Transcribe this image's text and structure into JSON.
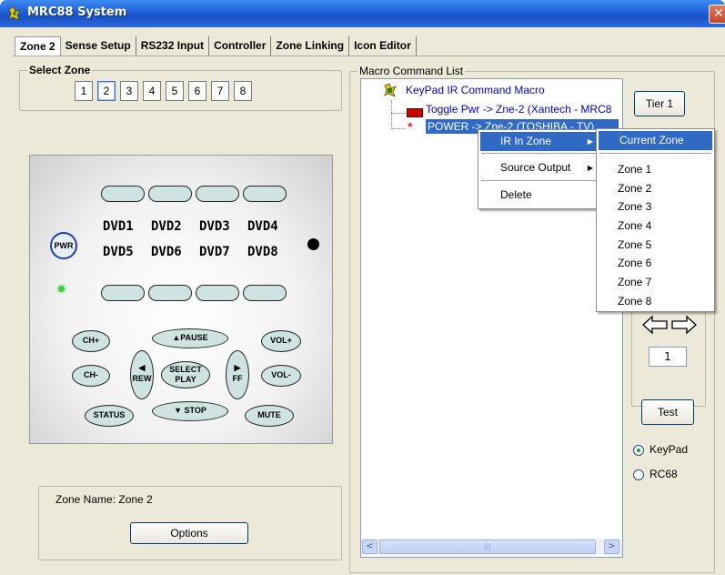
{
  "window": {
    "title": "MRC88 System",
    "close_glyph": "✕"
  },
  "tabs": [
    "Zone 2",
    "Sense Setup",
    "RS232 Input",
    "Controller",
    "Zone Linking",
    "Icon Editor"
  ],
  "select_zone": {
    "label": "Select Zone",
    "buttons": [
      "1",
      "2",
      "3",
      "4",
      "5",
      "6",
      "7",
      "8"
    ],
    "selected": "2"
  },
  "keypad": {
    "power_label": "PWR",
    "dvd_row1": [
      "DVD1",
      "DVD2",
      "DVD3",
      "DVD4"
    ],
    "dvd_row2": [
      "DVD5",
      "DVD6",
      "DVD7",
      "DVD8"
    ],
    "buttons": {
      "ch_up": "CH+",
      "ch_down": "CH-",
      "pause": "▲PAUSE",
      "stop": "▼ STOP",
      "rew": "REW",
      "ff": "FF",
      "select1": "SELECT",
      "select2": "PLAY",
      "vol_up": "VOL+",
      "vol_down": "VOL-",
      "status": "STATUS",
      "mute": "MUTE"
    }
  },
  "zone_info": {
    "zone_name": "Zone Name: Zone 2",
    "options_button": "Options"
  },
  "macro": {
    "label": "Macro Command List",
    "root": "KeyPad IR Command Macro",
    "item1": "Toggle Pwr -> Zne-2 (Xantech - MRC8",
    "item2": "POWER -> Zne-2 (TOSHIBA - TV)"
  },
  "controls": {
    "tier_button": "Tier 1",
    "spin_value": "1",
    "test_button": "Test",
    "radio_keypad": "KeyPad",
    "radio_rc68": "RC68",
    "radio_selected": "KeyPad"
  },
  "context_menu": {
    "items": [
      "IR In Zone",
      "Source Output",
      "Delete"
    ],
    "highlighted": "IR In Zone"
  },
  "submenu": {
    "items": [
      "Current Zone",
      "Zone 1",
      "Zone 2",
      "Zone 3",
      "Zone 4",
      "Zone 5",
      "Zone 6",
      "Zone 7",
      "Zone 8"
    ],
    "highlighted": "Current Zone"
  },
  "scrollbar": {
    "thumb_grip": "|||",
    "left_arrow": "<",
    "right_arrow": ">"
  },
  "colors": {
    "titlebar": "#2160d8",
    "selection": "#316ac5",
    "tree_text": "#0000cc"
  }
}
